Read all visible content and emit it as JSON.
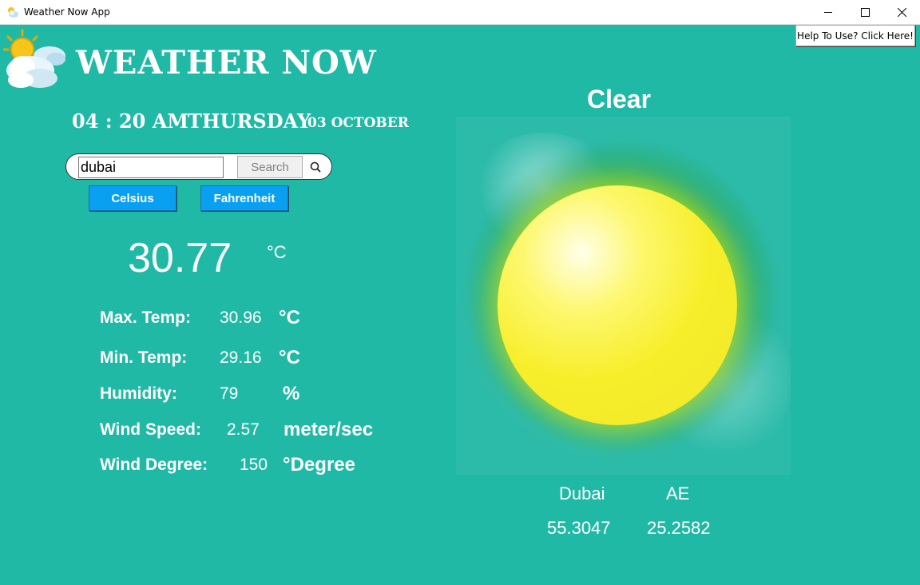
{
  "window": {
    "title": "Weather Now App"
  },
  "help_button": "Help To Use? Click Here!",
  "app_title": "Weather Now",
  "datetime": {
    "time": "04 : 20 AM",
    "day": "Thursday",
    "date": "03 October"
  },
  "search": {
    "value": "dubai",
    "button": "Search"
  },
  "units": {
    "celsius": "Celsius",
    "fahrenheit": "Fahrenheit"
  },
  "temperature": {
    "value": "30.77",
    "unit": "°C"
  },
  "stats": [
    {
      "label": "Max. Temp:",
      "value": "30.96",
      "unit": "°C"
    },
    {
      "label": "Min. Temp:",
      "value": "29.16",
      "unit": "°C"
    },
    {
      "label": "Humidity:",
      "value": "79",
      "unit": "%"
    },
    {
      "label": "Wind Speed:",
      "value": "2.57",
      "unit": "meter/sec"
    },
    {
      "label": "Wind Degree:",
      "value": "150",
      "unit": "°Degree"
    }
  ],
  "condition": "Clear",
  "location": {
    "city": "Dubai",
    "country": "AE",
    "lon": "55.3047",
    "lat": "25.2582"
  },
  "colors": {
    "background": "#20b9a6",
    "button": "#0aa0f2",
    "sun": "#f7ee2a"
  }
}
